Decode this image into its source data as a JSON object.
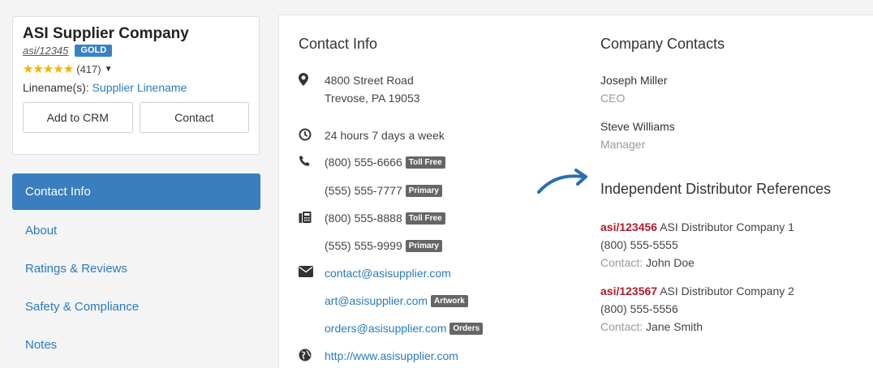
{
  "supplier": {
    "name": "ASI Supplier Company",
    "asi_number": "asi/12345",
    "badge": "GOLD",
    "rating_count": "(417)",
    "linename_label": "Linename(s):",
    "linename_value": "Supplier Linename",
    "add_to_crm_label": "Add to CRM",
    "contact_label": "Contact",
    "stars": 5
  },
  "nav": {
    "items": [
      {
        "label": "Contact Info"
      },
      {
        "label": "About"
      },
      {
        "label": "Ratings & Reviews"
      },
      {
        "label": "Safety & Compliance"
      },
      {
        "label": "Notes"
      }
    ]
  },
  "contact_info": {
    "title": "Contact Info",
    "address_line1": "4800 Street Road",
    "address_line2": "Trevose, PA 19053",
    "hours": "24 hours 7 days a week",
    "phones": [
      {
        "number": "(800) 555-6666",
        "tag": "Toll Free"
      },
      {
        "number": "(555) 555-7777",
        "tag": "Primary"
      }
    ],
    "faxes": [
      {
        "number": "(800) 555-8888",
        "tag": "Toll Free"
      },
      {
        "number": "(555) 555-9999",
        "tag": "Primary"
      }
    ],
    "emails": [
      {
        "address": "contact@asisupplier.com",
        "tag": ""
      },
      {
        "address": "art@asisupplier.com",
        "tag": "Artwork"
      },
      {
        "address": "orders@asisupplier.com",
        "tag": "Orders"
      }
    ],
    "website": "http://www.asisupplier.com"
  },
  "company_contacts": {
    "title": "Company Contacts",
    "people": [
      {
        "name": "Joseph Miller",
        "role": "CEO"
      },
      {
        "name": "Steve Williams",
        "role": "Manager"
      }
    ]
  },
  "references": {
    "title": "Independent Distributor References",
    "contact_label": "Contact:",
    "items": [
      {
        "asi": "asi/123456",
        "company": "ASI Distributor Company 1",
        "phone": "(800) 555-5555",
        "contact": "John Doe"
      },
      {
        "asi": "asi/123567",
        "company": "ASI Distributor Company 2",
        "phone": "(800) 555-5556",
        "contact": "Jane Smith"
      }
    ]
  },
  "colors": {
    "accent": "#3a7ec0",
    "link": "#2a7bbd",
    "asi_red": "#b01c2e",
    "star": "#f0b400"
  }
}
